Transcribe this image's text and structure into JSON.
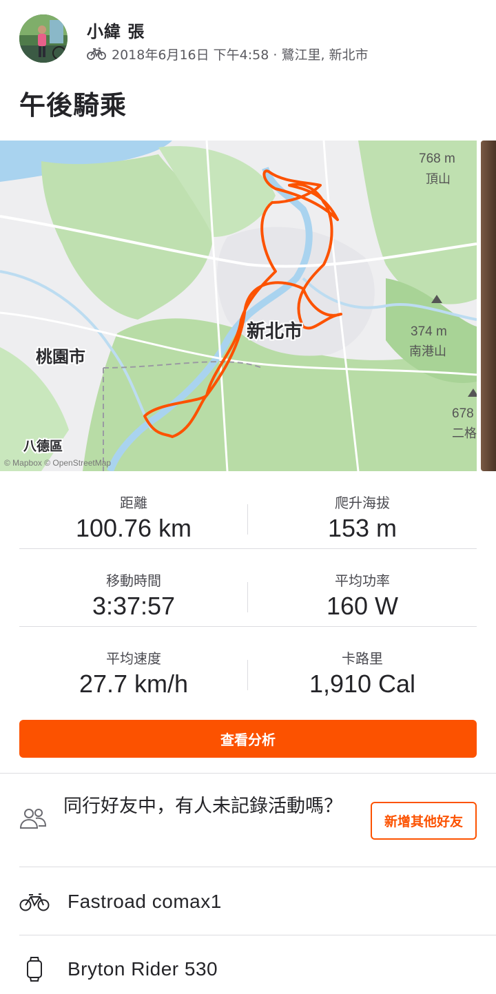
{
  "athlete": {
    "name": "小緯 張"
  },
  "activity": {
    "meta": "2018年6月16日 下午4:58 · 鷺江里, 新北市",
    "title": "午後騎乘",
    "type_icon": "bicycle-icon"
  },
  "map": {
    "city_label": "新北市",
    "taoyuan_label": "桃園市",
    "bade_label": "八德區",
    "peak1_elev": "768 m",
    "peak1_name": "頂山",
    "peak2_elev": "374 m",
    "peak2_name": "南港山",
    "peak3_elev": "678",
    "peak3_name": "二格",
    "attribution": "© Mapbox © OpenStreetMap",
    "route_color": "#fc5200"
  },
  "stats": [
    {
      "label": "距離",
      "value": "100.76 km"
    },
    {
      "label": "爬升海拔",
      "value": "153 m"
    },
    {
      "label": "移動時間",
      "value": "3:37:57"
    },
    {
      "label": "平均功率",
      "value": "160 W"
    },
    {
      "label": "平均速度",
      "value": "27.7 km/h"
    },
    {
      "label": "卡路里",
      "value": "1,910 Cal"
    }
  ],
  "analysis_button": "查看分析",
  "friends_prompt": {
    "text": "同行好友中，有人未記錄活動嗎？",
    "button": "新增其他好友"
  },
  "gear": {
    "bike": "Fastroad comax1",
    "device": "Bryton Rider 530"
  },
  "colors": {
    "brand": "#fc5200",
    "text": "#242428",
    "divider": "#dcdce0"
  }
}
